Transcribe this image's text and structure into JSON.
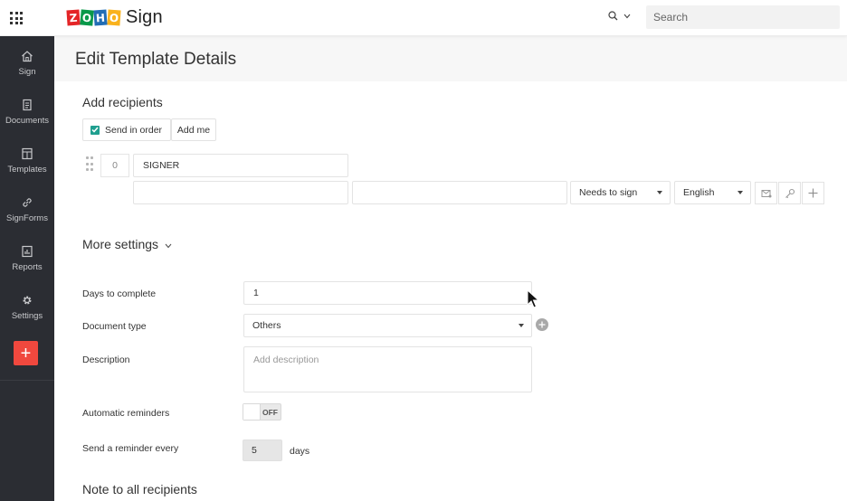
{
  "app": {
    "brand_logo_text": "ZOHO",
    "product_name": "Sign",
    "search_placeholder": "Search"
  },
  "sidebar": {
    "items": [
      {
        "label": "Sign",
        "icon": "home-icon"
      },
      {
        "label": "Documents",
        "icon": "documents-icon"
      },
      {
        "label": "Templates",
        "icon": "templates-icon"
      },
      {
        "label": "SignForms",
        "icon": "link-icon"
      },
      {
        "label": "Reports",
        "icon": "reports-icon"
      },
      {
        "label": "Settings",
        "icon": "gear-icon"
      }
    ],
    "add_button_label": "+"
  },
  "page": {
    "title": "Edit Template Details"
  },
  "recipients": {
    "section_title": "Add recipients",
    "send_in_order_label": "Send in order",
    "send_in_order_checked": true,
    "add_me_label": "Add me",
    "rows": [
      {
        "order": "0",
        "role": "SIGNER",
        "name": "",
        "email": "",
        "action": "Needs to sign",
        "language": "English"
      }
    ]
  },
  "more_settings": {
    "title": "More settings",
    "days_to_complete_label": "Days to complete",
    "days_to_complete_value": "1",
    "document_type_label": "Document type",
    "document_type_value": "Others",
    "description_label": "Description",
    "description_placeholder": "Add description",
    "auto_reminders_label": "Automatic reminders",
    "auto_reminders_state": "OFF",
    "reminder_every_label": "Send a reminder every",
    "reminder_every_value": "5",
    "reminder_every_unit": "days"
  },
  "notes": {
    "section_title": "Note to all recipients"
  },
  "colors": {
    "sidebar_bg": "#2b2d33",
    "accent_red": "#f0483e",
    "checkbox_teal": "#1f9f8f"
  }
}
